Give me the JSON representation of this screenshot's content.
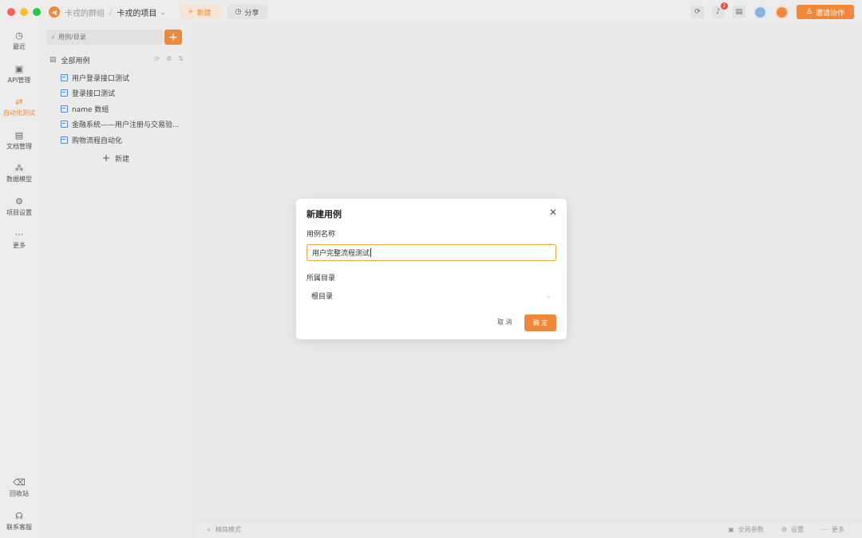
{
  "topbar": {
    "team": "卡戎的群组",
    "separator": "/",
    "project": "卡戎的项目",
    "new_label": "新建",
    "share_label": "分享",
    "notification_count": "2",
    "invite_label": "邀请协作"
  },
  "nav": {
    "items": [
      {
        "label": "最近",
        "icon": "history-icon",
        "glyph": "◷"
      },
      {
        "label": "API管理",
        "icon": "api-icon",
        "glyph": "▣"
      },
      {
        "label": "自动化测试",
        "icon": "automation-icon",
        "glyph": "⇄"
      },
      {
        "label": "文档管理",
        "icon": "document-icon",
        "glyph": "▤"
      },
      {
        "label": "数据模型",
        "icon": "data-model-icon",
        "glyph": "⁂"
      },
      {
        "label": "项目设置",
        "icon": "project-settings-icon",
        "glyph": "⚙"
      },
      {
        "label": "更多",
        "icon": "more-icon",
        "glyph": "⋯"
      }
    ],
    "bottom": [
      {
        "label": "回收站",
        "icon": "trash-icon",
        "glyph": "🗑"
      },
      {
        "label": "联系客服",
        "icon": "headset-icon",
        "glyph": "☊"
      }
    ],
    "active": "自动化测试"
  },
  "tree": {
    "search_placeholder": "用例/目录",
    "root_label": "全部用例",
    "cases": [
      "用户登录接口测试",
      "登录接口测试",
      "name 数组",
      "金融系统——用户注册与交易验...",
      "购物流程自动化"
    ],
    "new_label": "新建"
  },
  "modal": {
    "title": "新建用例",
    "name_label": "用例名称",
    "name_value": "用户完整流程测试",
    "dir_label": "所属目录",
    "dir_value": "根目录",
    "cancel_label": "取 消",
    "ok_label": "确 定"
  },
  "statusbar": {
    "left": "精简模式",
    "global_params": "全局参数",
    "settings": "设置",
    "more": "更多"
  },
  "colors": {
    "accent": "#f0883a",
    "input_focus_border": "#f0a54a",
    "case_icon": "#4a8fe0"
  }
}
